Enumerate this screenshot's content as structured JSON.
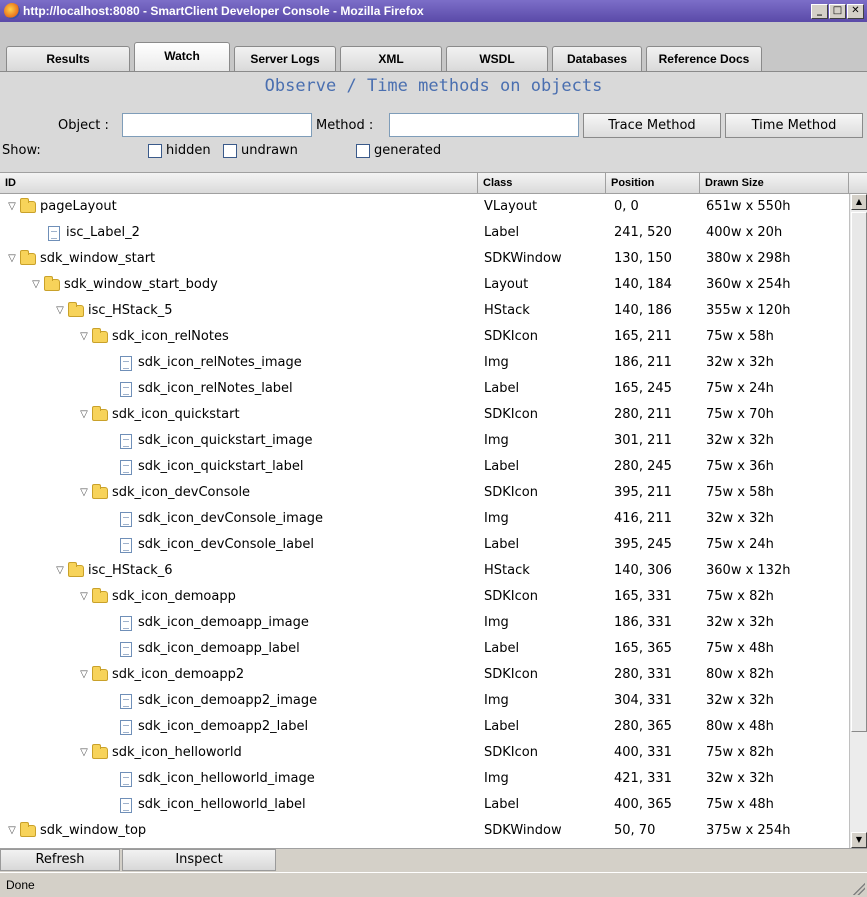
{
  "window": {
    "title": "http://localhost:8080 - SmartClient Developer Console - Mozilla Firefox"
  },
  "tabs": [
    {
      "label": "Results",
      "active": false
    },
    {
      "label": "Watch",
      "active": true
    },
    {
      "label": "Server Logs",
      "active": false
    },
    {
      "label": "XML",
      "active": false
    },
    {
      "label": "WSDL",
      "active": false
    },
    {
      "label": "Databases",
      "active": false
    },
    {
      "label": "Reference Docs",
      "active": false
    }
  ],
  "panel": {
    "title": "Observe / Time methods on objects",
    "object_label": "Object :",
    "object_value": "",
    "method_label": "Method :",
    "method_value": "",
    "trace_button": "Trace Method",
    "time_button": "Time Method",
    "show_label": "Show:",
    "checkboxes": [
      {
        "label": "hidden",
        "checked": false
      },
      {
        "label": "undrawn",
        "checked": false
      },
      {
        "label": "generated",
        "checked": false
      }
    ]
  },
  "grid": {
    "columns": [
      "ID",
      "Class",
      "Position",
      "Drawn Size"
    ],
    "rows": [
      {
        "id": "pageLayout",
        "depth": 0,
        "type": "folder",
        "class": "VLayout",
        "position": "0, 0",
        "size": "651w x 550h"
      },
      {
        "id": "isc_Label_2",
        "depth": 1,
        "type": "file",
        "class": "Label",
        "position": "241, 520",
        "size": "400w x 20h"
      },
      {
        "id": "sdk_window_start",
        "depth": 0,
        "type": "folder",
        "class": "SDKWindow",
        "position": "130, 150",
        "size": "380w x 298h"
      },
      {
        "id": "sdk_window_start_body",
        "depth": 1,
        "type": "folder",
        "class": "Layout",
        "position": "140, 184",
        "size": "360w x 254h"
      },
      {
        "id": "isc_HStack_5",
        "depth": 2,
        "type": "folder",
        "class": "HStack",
        "position": "140, 186",
        "size": "355w x 120h"
      },
      {
        "id": "sdk_icon_relNotes",
        "depth": 3,
        "type": "folder",
        "class": "SDKIcon",
        "position": "165, 211",
        "size": "75w x 58h"
      },
      {
        "id": "sdk_icon_relNotes_image",
        "depth": 4,
        "type": "file",
        "class": "Img",
        "position": "186, 211",
        "size": "32w x 32h"
      },
      {
        "id": "sdk_icon_relNotes_label",
        "depth": 4,
        "type": "file",
        "class": "Label",
        "position": "165, 245",
        "size": "75w x 24h"
      },
      {
        "id": "sdk_icon_quickstart",
        "depth": 3,
        "type": "folder",
        "class": "SDKIcon",
        "position": "280, 211",
        "size": "75w x 70h"
      },
      {
        "id": "sdk_icon_quickstart_image",
        "depth": 4,
        "type": "file",
        "class": "Img",
        "position": "301, 211",
        "size": "32w x 32h"
      },
      {
        "id": "sdk_icon_quickstart_label",
        "depth": 4,
        "type": "file",
        "class": "Label",
        "position": "280, 245",
        "size": "75w x 36h"
      },
      {
        "id": "sdk_icon_devConsole",
        "depth": 3,
        "type": "folder",
        "class": "SDKIcon",
        "position": "395, 211",
        "size": "75w x 58h"
      },
      {
        "id": "sdk_icon_devConsole_image",
        "depth": 4,
        "type": "file",
        "class": "Img",
        "position": "416, 211",
        "size": "32w x 32h"
      },
      {
        "id": "sdk_icon_devConsole_label",
        "depth": 4,
        "type": "file",
        "class": "Label",
        "position": "395, 245",
        "size": "75w x 24h"
      },
      {
        "id": "isc_HStack_6",
        "depth": 2,
        "type": "folder",
        "class": "HStack",
        "position": "140, 306",
        "size": "360w x 132h"
      },
      {
        "id": "sdk_icon_demoapp",
        "depth": 3,
        "type": "folder",
        "class": "SDKIcon",
        "position": "165, 331",
        "size": "75w x 82h"
      },
      {
        "id": "sdk_icon_demoapp_image",
        "depth": 4,
        "type": "file",
        "class": "Img",
        "position": "186, 331",
        "size": "32w x 32h"
      },
      {
        "id": "sdk_icon_demoapp_label",
        "depth": 4,
        "type": "file",
        "class": "Label",
        "position": "165, 365",
        "size": "75w x 48h"
      },
      {
        "id": "sdk_icon_demoapp2",
        "depth": 3,
        "type": "folder",
        "class": "SDKIcon",
        "position": "280, 331",
        "size": "80w x 82h"
      },
      {
        "id": "sdk_icon_demoapp2_image",
        "depth": 4,
        "type": "file",
        "class": "Img",
        "position": "304, 331",
        "size": "32w x 32h"
      },
      {
        "id": "sdk_icon_demoapp2_label",
        "depth": 4,
        "type": "file",
        "class": "Label",
        "position": "280, 365",
        "size": "80w x 48h"
      },
      {
        "id": "sdk_icon_helloworld",
        "depth": 3,
        "type": "folder",
        "class": "SDKIcon",
        "position": "400, 331",
        "size": "75w x 82h"
      },
      {
        "id": "sdk_icon_helloworld_image",
        "depth": 4,
        "type": "file",
        "class": "Img",
        "position": "421, 331",
        "size": "32w x 32h"
      },
      {
        "id": "sdk_icon_helloworld_label",
        "depth": 4,
        "type": "file",
        "class": "Label",
        "position": "400, 365",
        "size": "75w x 48h"
      },
      {
        "id": "sdk_window_top",
        "depth": 0,
        "type": "folder",
        "class": "SDKWindow",
        "position": "50, 70",
        "size": "375w x 254h"
      }
    ]
  },
  "bottom": {
    "refresh": "Refresh",
    "inspect": "Inspect"
  },
  "status": "Done"
}
